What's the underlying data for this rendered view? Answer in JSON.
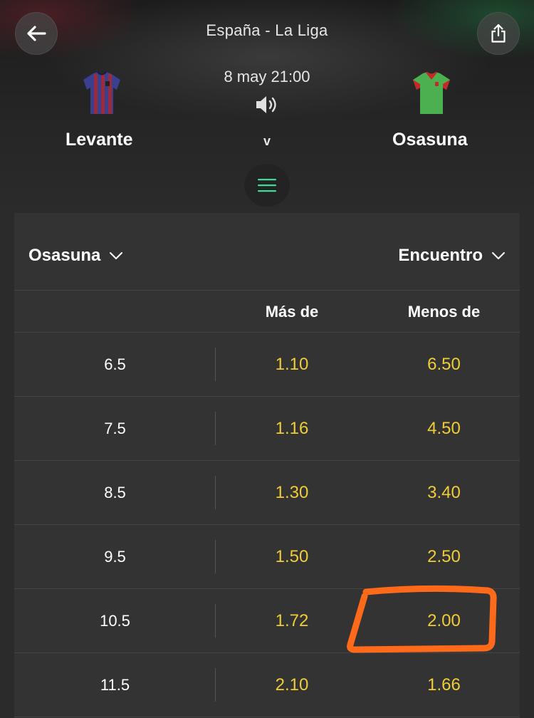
{
  "header": {
    "league": "España - La Liga",
    "datetime": "8 may 21:00",
    "versus": "v",
    "home_team": {
      "name": "Levante",
      "jersey_color": "#3b3f8f",
      "jersey_stripe": "#9a2b3b"
    },
    "away_team": {
      "name": "Osasuna",
      "jersey_color": "#4caf50",
      "jersey_trim": "#c62828"
    },
    "icons": {
      "back": "back-arrow-icon",
      "share": "share-icon",
      "sound": "speaker-icon",
      "menu": "hamburger-menu-icon"
    }
  },
  "market": {
    "team_selector": "Osasuna",
    "scope_selector": "Encuentro",
    "columns": {
      "over": "Más de",
      "under": "Menos de"
    },
    "rows": [
      {
        "line": "6.5",
        "over": "1.10",
        "under": "6.50"
      },
      {
        "line": "7.5",
        "over": "1.16",
        "under": "4.50"
      },
      {
        "line": "8.5",
        "over": "1.30",
        "under": "3.40"
      },
      {
        "line": "9.5",
        "over": "1.50",
        "under": "2.50"
      },
      {
        "line": "10.5",
        "over": "1.72",
        "under": "2.00"
      },
      {
        "line": "11.5",
        "over": "2.10",
        "under": "1.66"
      }
    ]
  },
  "colors": {
    "odds": "#f0cc37",
    "menu_accent": "#3ddc97",
    "highlight": "#ff6a1a",
    "card_bg": "#333333"
  },
  "annotation": {
    "highlighted_odd": "2.00"
  }
}
